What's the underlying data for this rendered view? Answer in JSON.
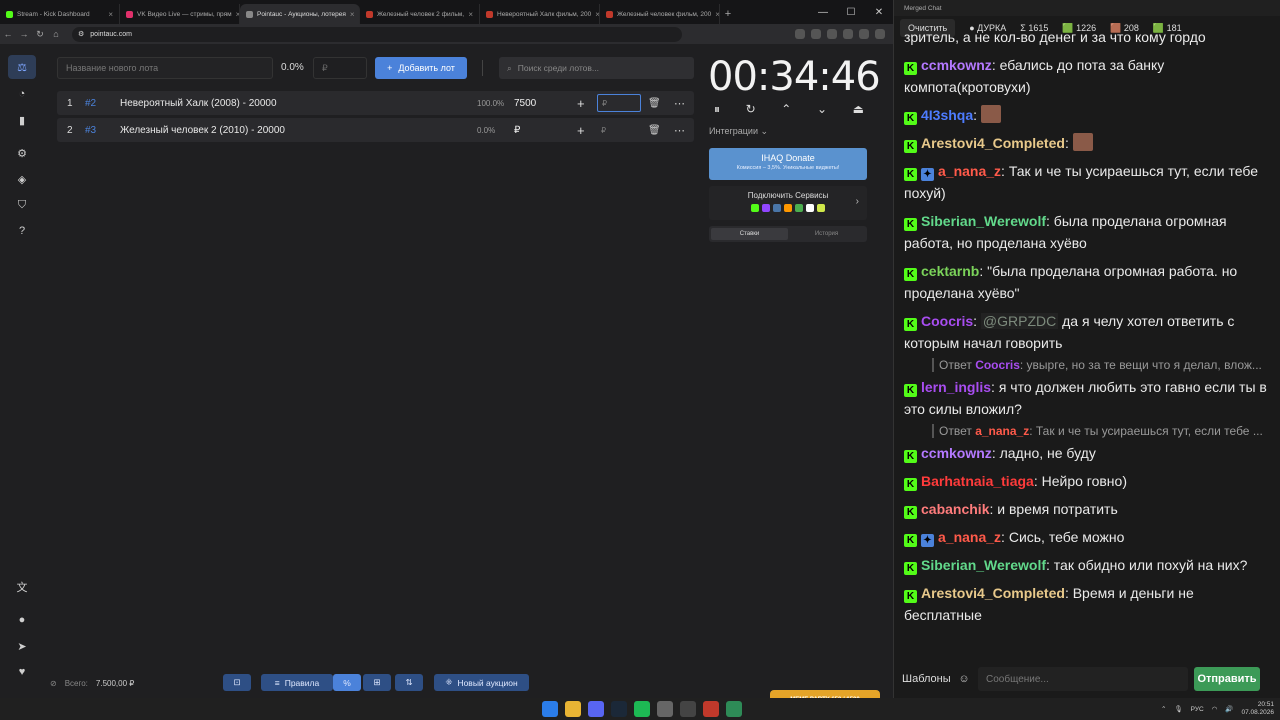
{
  "browser": {
    "tabs": [
      {
        "title": "Stream - Kick Dashboard",
        "color": "#53fc18"
      },
      {
        "title": "VK Видео Live — стримы, прям",
        "color": "#e0306b"
      },
      {
        "title": "Pointauc - Аукционы, лотерея",
        "color": "#888888"
      },
      {
        "title": "Железный человек 2 фильм,",
        "color": "#c0392b"
      },
      {
        "title": "Невероятный Халк фильм, 200",
        "color": "#c0392b"
      },
      {
        "title": "Железный человек фильм, 200",
        "color": "#c0392b"
      }
    ],
    "new_tab": "+",
    "url": "pointauc.com",
    "window_controls": [
      "—",
      "☐",
      "✕"
    ]
  },
  "sidebar": {
    "icons": [
      "gavel-icon",
      "pie-chart-icon",
      "bar-chart-icon",
      "settings-icon",
      "layers-icon",
      "shield-icon",
      "help-icon",
      "translate-icon",
      "github-icon",
      "telegram-icon",
      "donate-icon"
    ]
  },
  "toolbar": {
    "lot_placeholder": "Название нового лота",
    "percent": "0.0%",
    "amount_placeholder": "₽",
    "add_label": "Добавить лот",
    "search_placeholder": "Поиск среди лотов..."
  },
  "lots": [
    {
      "index": "1",
      "id": "#2",
      "name": "Невероятный Халк (2008) - 20000",
      "percent": "100.0%",
      "amount": "7500",
      "input_placeholder": "₽"
    },
    {
      "index": "2",
      "id": "#3",
      "name": "Железный человек 2 (2010) - 20000",
      "percent": "0.0%",
      "amount": "₽",
      "input_placeholder": "₽"
    }
  ],
  "timer": {
    "value": "00:34:46",
    "controls": [
      "⏸",
      "↻",
      "⌃",
      "⌄",
      "⏏"
    ],
    "integrations_label": "Интеграции ⌄"
  },
  "donate": {
    "title": "IHAQ Donate",
    "subtitle": "Комиссия – 3,5%. Уникальные виджеты!"
  },
  "services": {
    "title": "Подключить Сервисы",
    "icon_colors": [
      "#53fc18",
      "#9146ff",
      "#4a76a8",
      "#ff9800",
      "#4caf50",
      "#ffffff",
      "#d0e84a"
    ]
  },
  "tabs_panel": {
    "bids": "Ставки",
    "history": "История"
  },
  "bottom": {
    "total_label": "Всего:",
    "total_value": "7.500,00 ₽",
    "rules_label": "Правила",
    "new_auction_label": "Новый аукцион"
  },
  "chat": {
    "window_title": "Merged Chat",
    "clear_label": "Очистить",
    "stats": [
      "● ДУРКА",
      "Σ 1615",
      "🟩 1226",
      "🟫 208",
      "🟩 181"
    ],
    "top_cut": "зритель, а не кол-во денег и за что кому гордо",
    "messages": [
      {
        "user": "ccmkownz",
        "color": "#b479ff",
        "text": "ебались до пота за банку компота(кротовухи)"
      },
      {
        "user": "4I3shqa",
        "color": "#4d7cff",
        "text": "",
        "emote": true
      },
      {
        "user": "Arestovi4_Completed",
        "color": "#e8c98b",
        "text": "",
        "emote": true
      },
      {
        "user": "a_nana_z",
        "color": "#ff5a4a",
        "text": "Так и че ты усираешься тут, если тебе похуй)",
        "badge": true
      },
      {
        "user": "Siberian_Werewolf",
        "color": "#62d98b",
        "text": "была проделана огромная работа, но проделана хуёво"
      },
      {
        "user": "cektarnb",
        "color": "#7bd35a",
        "text": "\"была проделана огромная работа. но проделана хуёво\""
      },
      {
        "user": "Coocris",
        "color": "#a84df0",
        "text": "да я челу хотел ответить с которым начал говорить",
        "mention": "@GRPZDC"
      },
      {
        "user": "lern_inglis",
        "color": "#a84df0",
        "text": "я что должен любить это гавно если ты в это силы вложил?",
        "reply_to": "Coocris",
        "reply_text": "увырге, но за те вещи что я делал, влож..."
      },
      {
        "user": "ccmkownz",
        "color": "#b479ff",
        "text": "ладно, не буду",
        "reply_to": "a_nana_z",
        "reply_text": "Так и че ты усираешься тут, если тебе ..."
      },
      {
        "user": "Barhatnaia_tiaga",
        "color": "#ff3b3b",
        "text": "Нейро говно)"
      },
      {
        "user": "cabanchik",
        "color": "#ff7c7c",
        "text": "и время потратить"
      },
      {
        "user": "a_nana_z",
        "color": "#ff5a4a",
        "text": "Сись, тебе можно",
        "badge": true
      },
      {
        "user": "Siberian_Werewolf",
        "color": "#62d98b",
        "text": "так обидно или похуй на них?"
      },
      {
        "user": "Arestovi4_Completed",
        "color": "#e8c98b",
        "text": "Время и деньги не бесплатные"
      }
    ],
    "templates_label": "Шаблоны",
    "input_placeholder": "Сообщение...",
    "send_label": "Отправить"
  },
  "taskbar": {
    "meme": "MEME PARTY  650 / 1500",
    "lang": "РУС",
    "time": "20:51",
    "date": "07.08.2026"
  }
}
